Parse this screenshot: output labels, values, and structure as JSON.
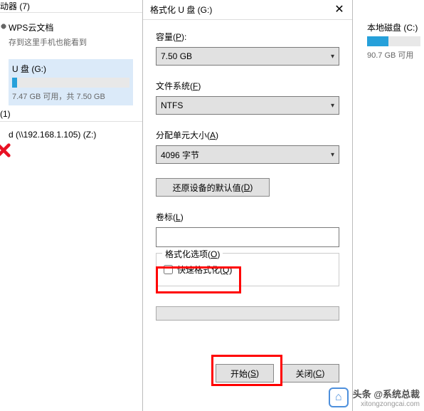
{
  "explorer": {
    "section1": "动器 (7)",
    "section2": "(1)",
    "wps": {
      "name": "WPS云文档",
      "sub": "存到这里手机也能看到"
    },
    "udisk": {
      "name": "U 盘 (G:)",
      "sub": "7.47 GB 可用，共 7.50 GB"
    },
    "netdrive": {
      "name": "d (\\\\192.168.1.105) (Z:)"
    },
    "local": {
      "name": "本地磁盘 (C:)",
      "sub": "90.7 GB 可用"
    }
  },
  "dialog": {
    "title": "格式化 U 盘 (G:)",
    "capacity_label_pre": "容量(",
    "capacity_label_u": "P",
    "capacity_label_post": "):",
    "capacity_value": "7.50 GB",
    "fs_label_pre": "文件系统(",
    "fs_label_u": "F",
    "fs_label_post": ")",
    "fs_value": "NTFS",
    "alloc_label_pre": "分配单元大小(",
    "alloc_label_u": "A",
    "alloc_label_post": ")",
    "alloc_value": "4096 字节",
    "restore_pre": "还原设备的默认值(",
    "restore_u": "D",
    "restore_post": ")",
    "vol_label_pre": "卷标(",
    "vol_label_u": "L",
    "vol_label_post": ")",
    "vol_value": "",
    "opts_label_pre": "格式化选项(",
    "opts_label_u": "O",
    "opts_label_post": ")",
    "quick_pre": "快速格式化(",
    "quick_u": "Q",
    "quick_post": ")",
    "start_pre": "开始(",
    "start_u": "S",
    "start_post": ")",
    "close_pre": "关闭(",
    "close_u": "C",
    "close_post": ")"
  },
  "watermark": {
    "line1": "头条 @系统总裁",
    "line2": "xitongzongcai.com"
  }
}
